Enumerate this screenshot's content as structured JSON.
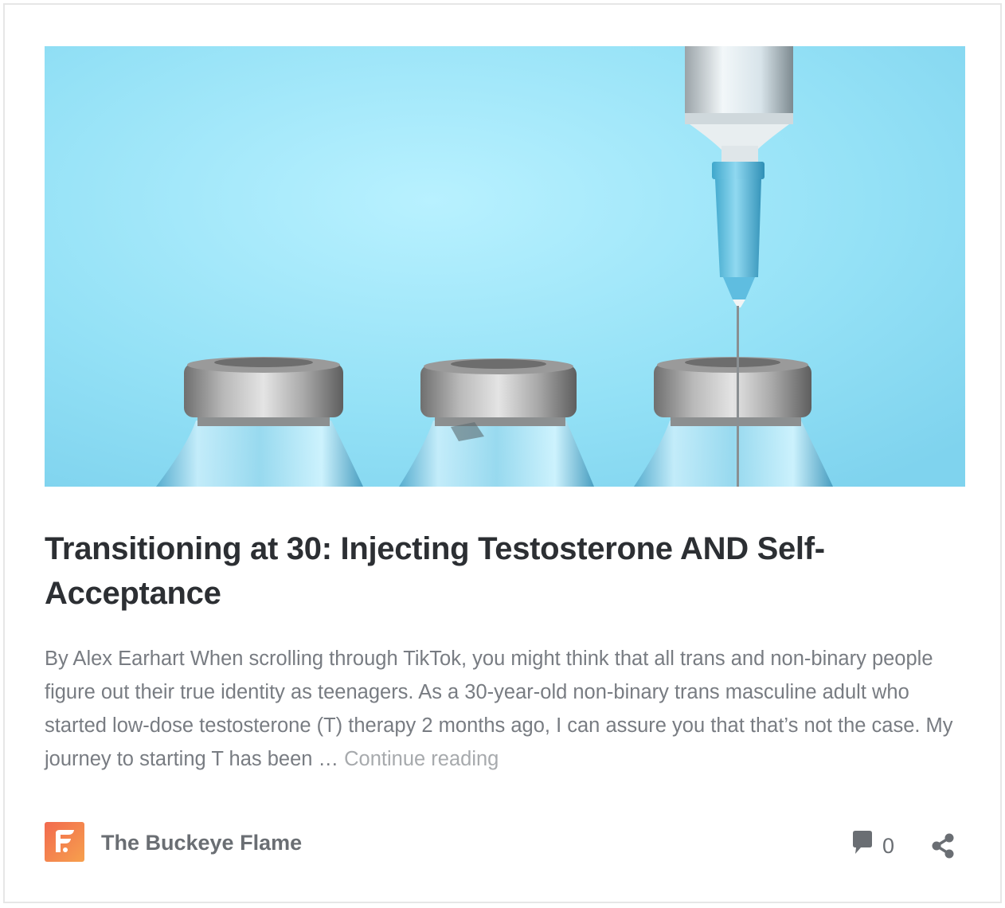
{
  "post": {
    "title": "Transitioning at 30: Injecting Testosterone AND Self-Acceptance",
    "excerpt": "By Alex Earhart When scrolling through TikTok, you might think that all trans and non-binary people figure out their true identity as teenagers. As a 30-year-old non-binary trans masculine adult who started low-dose testosterone (T) therapy 2 months ago, I can assure you that that’s not the case. My journey to starting T has been …",
    "continue_label": "Continue reading"
  },
  "footer": {
    "site_name": "The Buckeye Flame",
    "comment_count": "0"
  },
  "icons": {
    "site_logo": "buckeye-flame-logo",
    "comments": "speech-bubble-icon",
    "share": "share-icon"
  },
  "colors": {
    "logo_gradient_start": "#f26a4f",
    "logo_gradient_end": "#f6a04d",
    "hero_background": "#9fe3f6"
  }
}
